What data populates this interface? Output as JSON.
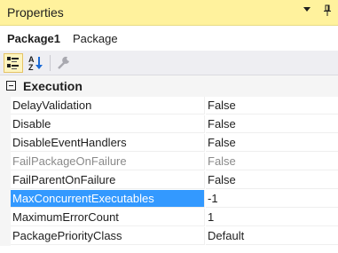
{
  "window": {
    "title": "Properties",
    "dropdown_icon": "chevron-down-icon",
    "pin_icon": "pin-icon"
  },
  "object": {
    "name": "Package1",
    "type": "Package"
  },
  "toolbar": {
    "categorized_icon": "categorized-view-icon",
    "alphabetical_icon": "sort-alphabetical-icon",
    "property_pages_icon": "wrench-icon"
  },
  "category": {
    "label": "Execution",
    "expanded": true
  },
  "properties": [
    {
      "name": "DelayValidation",
      "value": "False"
    },
    {
      "name": "Disable",
      "value": "False"
    },
    {
      "name": "DisableEventHandlers",
      "value": "False"
    },
    {
      "name": "FailPackageOnFailure",
      "value": "False"
    },
    {
      "name": "FailParentOnFailure",
      "value": "False"
    },
    {
      "name": "MaxConcurrentExecutables",
      "value": "-1"
    },
    {
      "name": "MaximumErrorCount",
      "value": "1"
    },
    {
      "name": "PackagePriorityClass",
      "value": "Default"
    }
  ],
  "colors": {
    "title_bar": "#fff29d",
    "selection": "#3399ff",
    "disabled_text": "#8a8a8a"
  }
}
